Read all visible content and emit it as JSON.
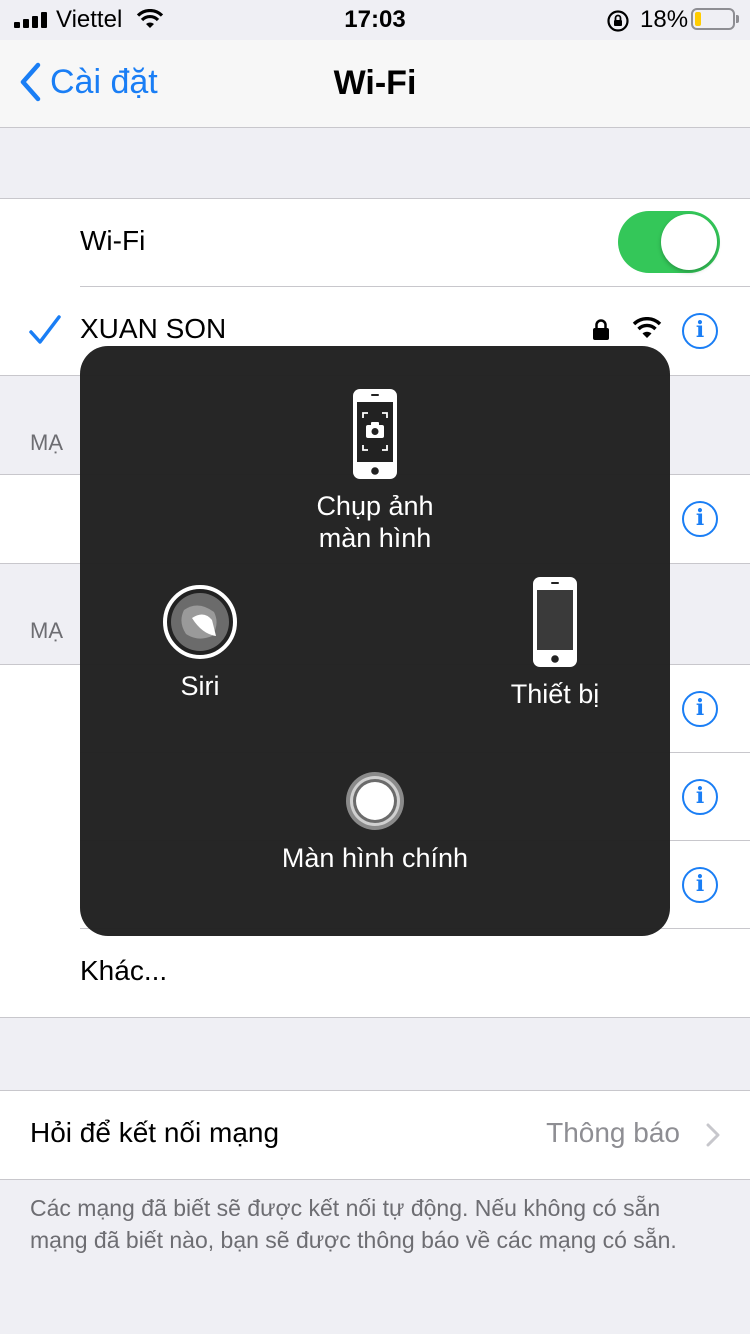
{
  "status_bar": {
    "carrier": "Viettel",
    "time": "17:03",
    "battery_percent": "18%",
    "battery_level": 0.18,
    "battery_color": "#ffcc00"
  },
  "nav": {
    "back_label": "Cài đặt",
    "title": "Wi-Fi"
  },
  "wifi_group": {
    "toggle_label": "Wi-Fi",
    "toggle_on": true,
    "toggle_color": "#34c759",
    "connected_network": "XUAN SON"
  },
  "section_headers": [
    "MẠ",
    "MẠ"
  ],
  "other_network_label": "Khác...",
  "ask_to_join": {
    "label": "Hỏi để kết nối mạng",
    "value": "Thông báo"
  },
  "footer_note": "Các mạng đã biết sẽ được kết nối tự động. Nếu không có sẵn mạng đã biết nào, bạn sẽ được thông báo về các mạng có sẵn.",
  "assistive_touch": {
    "screenshot_label_line1": "Chụp ảnh",
    "screenshot_label_line2": "màn hình",
    "siri_label": "Siri",
    "device_label": "Thiết bị",
    "home_label": "Màn hình chính"
  },
  "colors": {
    "accent": "#1a7ef5",
    "background": "#efeff4",
    "menu_background": "#222222"
  }
}
